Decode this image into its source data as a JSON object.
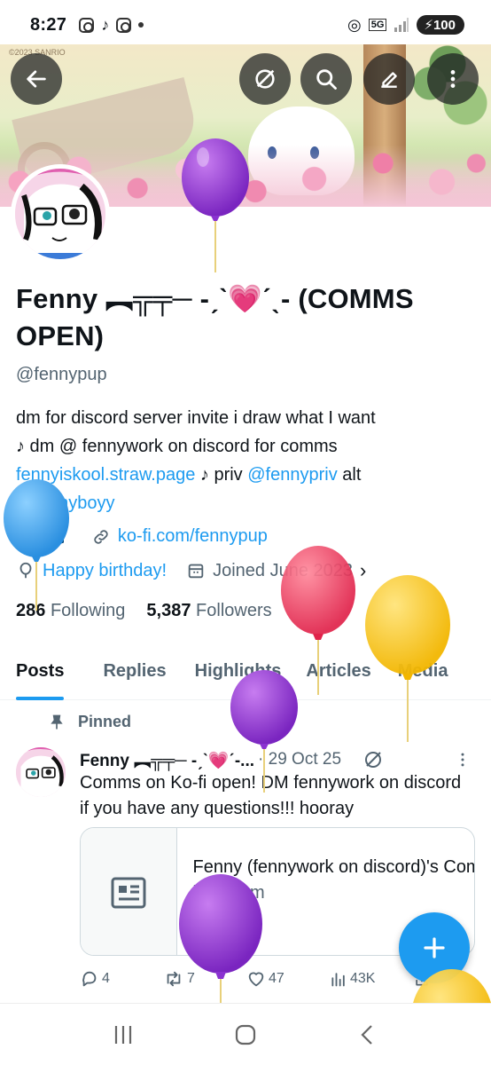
{
  "status_bar": {
    "time": "8:27",
    "network": "5G",
    "battery": "100"
  },
  "banner": {
    "copyright": "©2023 SANRIO"
  },
  "profile": {
    "name": "Fenny ︻╦╤─ -ˏˋ💗ˊˎ- (COMMS OPEN)",
    "handle": "@fennypup",
    "bio_line1": "dm for discord server invite i draw what I want",
    "bio_line2": "♪  dm @ fennywork on discord for comms",
    "bio_link": "fennyiskool.straw.page",
    "bio_mid": " ♪  priv ",
    "bio_priv": "@fennypriv",
    "bio_alt": "  alt",
    "bio_alt_handle": "@fennyboyy",
    "location_flag": "🇸🇪",
    "website": "ko-fi.com/fennypup",
    "birthday": "Happy birthday!",
    "joined": "Joined June 2023",
    "following_count": "286",
    "following_label": "Following",
    "followers_count": "5,387",
    "followers_label": "Followers"
  },
  "tabs": [
    "Posts",
    "Replies",
    "Highlights",
    "Articles",
    "Media"
  ],
  "tweet": {
    "pinned_label": "Pinned",
    "author": "Fenny ︻╦╤─ -ˏˋ💗ˊ-...",
    "date": "· 29 Oct 25",
    "text": "Comms on Ko-fi open! DM fennywork on discord if you have any questions!!! hooray",
    "card_title": "Fenny (fennywork on discord)'s Commissions ...",
    "card_domain": "ko-fi.com",
    "replies": "4",
    "reposts": "7",
    "likes": "47",
    "views": "43K"
  },
  "colors": {
    "accent": "#1d9bf0",
    "text": "#0f1419",
    "muted": "#536471"
  },
  "balloons": [
    {
      "color": "purple"
    },
    {
      "color": "blue"
    },
    {
      "color": "red"
    },
    {
      "color": "yellow"
    },
    {
      "color": "purple"
    },
    {
      "color": "purple"
    },
    {
      "color": "yellow"
    }
  ]
}
